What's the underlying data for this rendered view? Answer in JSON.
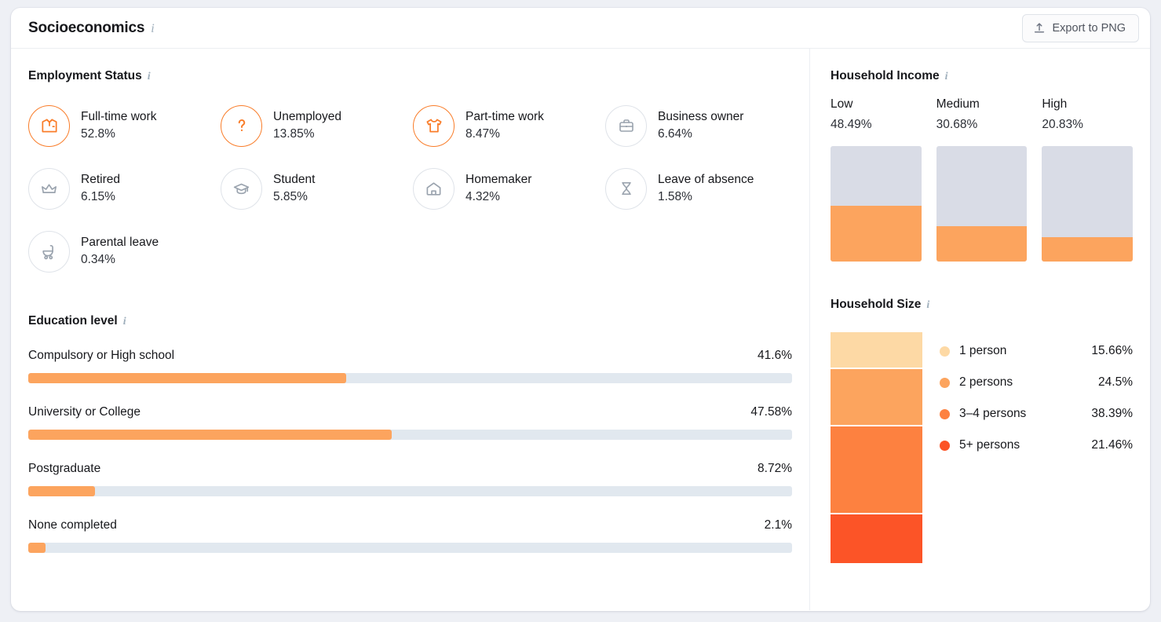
{
  "header": {
    "title": "Socioeconomics",
    "info_icon": "info-icon",
    "export_label": "Export to PNG",
    "export_icon": "upload-icon"
  },
  "employment": {
    "title": "Employment Status",
    "items": [
      {
        "label": "Full-time work",
        "value": "52.8%",
        "icon": "shirt-tie-icon",
        "highlight": true
      },
      {
        "label": "Unemployed",
        "value": "13.85%",
        "icon": "question-mark-icon",
        "highlight": true
      },
      {
        "label": "Part-time work",
        "value": "8.47%",
        "icon": "tshirt-icon",
        "highlight": true
      },
      {
        "label": "Business owner",
        "value": "6.64%",
        "icon": "briefcase-icon",
        "highlight": false
      },
      {
        "label": "Retired",
        "value": "6.15%",
        "icon": "crown-icon",
        "highlight": false
      },
      {
        "label": "Student",
        "value": "5.85%",
        "icon": "graduation-cap-icon",
        "highlight": false
      },
      {
        "label": "Homemaker",
        "value": "4.32%",
        "icon": "house-icon",
        "highlight": false
      },
      {
        "label": "Leave of absence",
        "value": "1.58%",
        "icon": "hourglass-icon",
        "highlight": false
      },
      {
        "label": "Parental leave",
        "value": "0.34%",
        "icon": "stroller-icon",
        "highlight": false
      }
    ]
  },
  "education": {
    "title": "Education level",
    "rows": [
      {
        "label": "Compulsory or High school",
        "value": "41.6%",
        "pct": 41.6
      },
      {
        "label": "University or College",
        "value": "47.58%",
        "pct": 47.58
      },
      {
        "label": "Postgraduate",
        "value": "8.72%",
        "pct": 8.72
      },
      {
        "label": "None completed",
        "value": "2.1%",
        "pct": 2.1
      }
    ]
  },
  "household_income": {
    "title": "Household Income",
    "columns": [
      {
        "label": "Low",
        "value": "48.49%",
        "pct": 48.49
      },
      {
        "label": "Medium",
        "value": "30.68%",
        "pct": 30.68
      },
      {
        "label": "High",
        "value": "20.83%",
        "pct": 20.83
      }
    ]
  },
  "household_size": {
    "title": "Household Size",
    "items": [
      {
        "label": "1 person",
        "value": "15.66%",
        "pct": 15.66,
        "color": "#fdd9a5"
      },
      {
        "label": "2 persons",
        "value": "24.5%",
        "pct": 24.5,
        "color": "#fca45e"
      },
      {
        "label": "3–4 persons",
        "value": "38.39%",
        "pct": 38.39,
        "color": "#fd8140"
      },
      {
        "label": "5+ persons",
        "value": "21.46%",
        "pct": 21.46,
        "color": "#fc5427"
      }
    ]
  },
  "chart_data": [
    {
      "type": "bar",
      "title": "Education level",
      "categories": [
        "Compulsory or High school",
        "University or College",
        "Postgraduate",
        "None completed"
      ],
      "values": [
        41.6,
        47.58,
        8.72,
        2.1
      ],
      "ylabel": "%",
      "xlabel": "",
      "ylim": [
        0,
        100
      ],
      "orientation": "horizontal",
      "grid": false,
      "legend": "none"
    },
    {
      "type": "bar",
      "title": "Household Income",
      "categories": [
        "Low",
        "Medium",
        "High"
      ],
      "values": [
        48.49,
        30.68,
        20.83
      ],
      "ylabel": "%",
      "xlabel": "",
      "ylim": [
        0,
        100
      ],
      "orientation": "vertical",
      "grid": false,
      "legend": "none"
    },
    {
      "type": "pie",
      "title": "Household Size",
      "categories": [
        "1 person",
        "2 persons",
        "3–4 persons",
        "5+ persons"
      ],
      "values": [
        15.66,
        24.5,
        38.39,
        21.46
      ],
      "colors": [
        "#fdd9a5",
        "#fca45e",
        "#fd8140",
        "#fc5427"
      ],
      "legend": "right"
    },
    {
      "type": "bar",
      "title": "Employment Status",
      "categories": [
        "Full-time work",
        "Unemployed",
        "Part-time work",
        "Business owner",
        "Retired",
        "Student",
        "Homemaker",
        "Leave of absence",
        "Parental leave"
      ],
      "values": [
        52.8,
        13.85,
        8.47,
        6.64,
        6.15,
        5.85,
        4.32,
        1.58,
        0.34
      ],
      "ylabel": "%",
      "xlabel": "",
      "legend": "none"
    }
  ]
}
